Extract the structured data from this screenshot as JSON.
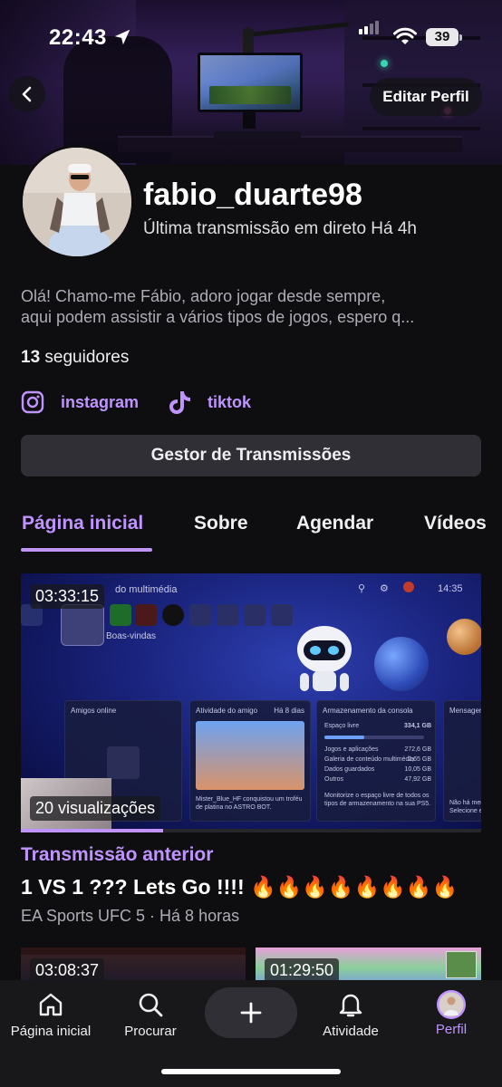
{
  "status_bar": {
    "time": "22:43",
    "battery": "39"
  },
  "header": {
    "edit_profile_label": "Editar Perfil"
  },
  "profile": {
    "username": "fabio_duarte98",
    "last_stream": "Última transmissão em direto Há 4h",
    "bio_line1": "Olá! Chamo-me Fábio, adoro jogar desde sempre,",
    "bio_line2": "aqui podem assistir a vários tipos de jogos, espero q...",
    "followers_count": "13",
    "followers_label": "seguidores"
  },
  "socials": [
    {
      "label": "instagram",
      "icon": "instagram-icon"
    },
    {
      "label": "tiktok",
      "icon": "tiktok-icon"
    }
  ],
  "manager_button": "Gestor de Transmissões",
  "tabs": [
    {
      "label": "Página inicial",
      "active": true
    },
    {
      "label": "Sobre",
      "active": false
    },
    {
      "label": "Agendar",
      "active": false
    },
    {
      "label": "Vídeos",
      "active": false
    }
  ],
  "featured": {
    "duration": "03:33:15",
    "views": "20 visualizações",
    "watched_fraction": 0.31,
    "section_label": "Transmissão anterior",
    "title": "1 VS 1 ??? Lets Go !!!! 🔥🔥🔥🔥🔥🔥🔥🔥",
    "meta": "EA Sports UFC 5 · Há 8 horas",
    "screen_text": {
      "menu": "do multimédia",
      "clock": "14:35",
      "welcome": "Boas-vindas",
      "friends_online": "Amigos online",
      "friend_activity": "Atividade do amigo",
      "friend_activity_time": "Há 8 dias",
      "storage": "Armazenamento da consola",
      "free_space_label": "Espaço livre",
      "free_space": "334,1 GB",
      "storage_rows": [
        {
          "label": "Jogos e aplicações",
          "value": "272,6 GB"
        },
        {
          "label": "Galeria de conteúdo multimédia",
          "value": "2,65 GB"
        },
        {
          "label": "Dados guardados",
          "value": "10,05 GB"
        },
        {
          "label": "Outros",
          "value": "47,92 GB"
        }
      ],
      "storage_note": "Monitorize o espaço livre de todos os tipos de armazenamento na sua PS5.",
      "trophy_text": "Mister_Blue_HF conquistou um troféu de platina no ASTRO BOT.",
      "messages": "Mensager",
      "messages_note": "Não há mensa\nSelecione esta"
    }
  },
  "more_videos": [
    {
      "duration": "03:08:37"
    },
    {
      "duration": "01:29:50"
    }
  ],
  "bottom_nav": [
    {
      "label": "Página inicial",
      "icon": "home-icon"
    },
    {
      "label": "Procurar",
      "icon": "search-icon"
    },
    {
      "label": "Atividade",
      "icon": "bell-icon"
    },
    {
      "label": "Perfil",
      "icon": "avatar-icon",
      "active": true
    }
  ],
  "colors": {
    "accent": "#bf94ff",
    "background": "#0e0e10",
    "surface": "#2f2f35",
    "tabbar": "#18181b"
  }
}
